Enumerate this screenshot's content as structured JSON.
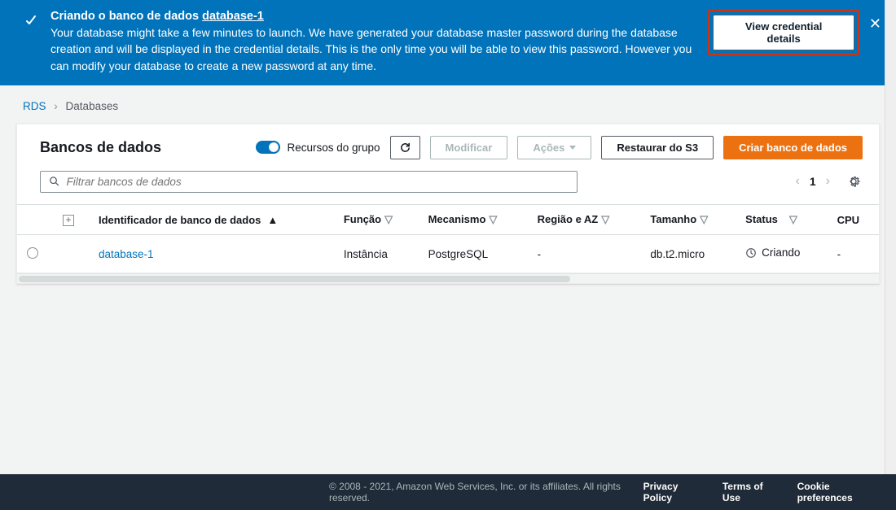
{
  "banner": {
    "title_prefix": "Criando o banco de dados ",
    "db_link": "database-1",
    "description": "Your database might take a few minutes to launch. We have generated your database master password during the database creation and will be displayed in the credential details. This is the only time you will be able to view this password. However you can modify your database to create a new password at any time.",
    "view_credentials_label": "View credential details"
  },
  "breadcrumb": {
    "root": "RDS",
    "current": "Databases"
  },
  "panel": {
    "title": "Bancos de dados",
    "group_toggle_label": "Recursos do grupo",
    "buttons": {
      "modify": "Modificar",
      "actions": "Ações",
      "restore_s3": "Restaurar do S3",
      "create_db": "Criar banco de dados"
    }
  },
  "filter": {
    "placeholder": "Filtrar bancos de dados"
  },
  "pager": {
    "page": "1"
  },
  "table": {
    "columns": {
      "identifier": "Identificador de banco de dados",
      "role": "Função",
      "engine": "Mecanismo",
      "region_az": "Região e AZ",
      "size": "Tamanho",
      "status": "Status",
      "cpu": "CPU"
    },
    "rows": [
      {
        "identifier": "database-1",
        "role": "Instância",
        "engine": "PostgreSQL",
        "region_az": "-",
        "size": "db.t2.micro",
        "status": "Criando",
        "cpu": "-"
      }
    ]
  },
  "footer": {
    "copyright": "© 2008 - 2021, Amazon Web Services, Inc. or its affiliates. All rights reserved.",
    "privacy": "Privacy Policy",
    "terms": "Terms of Use",
    "cookies": "Cookie preferences"
  }
}
